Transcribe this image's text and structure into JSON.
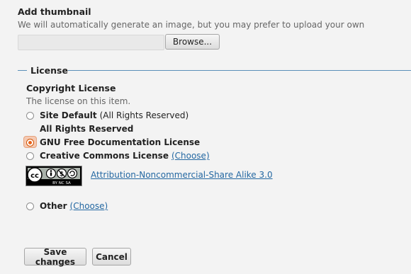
{
  "thumbnail": {
    "heading": "Add thumbnail",
    "help": "We will automatically generate an image, but you may prefer to upload your own",
    "browse_label": "Browse..."
  },
  "license": {
    "legend": "License",
    "heading": "Copyright License",
    "help": "The license on this item.",
    "options": [
      {
        "label": "Site Default",
        "suffix": "(All Rights Reserved)",
        "checked": false
      },
      {
        "label": "All Rights Reserved",
        "checked": false
      },
      {
        "label": "GNU Free Documentation License",
        "checked": true
      },
      {
        "label": "Creative Commons License",
        "link": "(Choose)",
        "checked": false
      },
      {
        "label": "Other",
        "link": "(Choose)",
        "checked": false
      }
    ],
    "cc_badge": {
      "text": "BY  NC  SA",
      "link": "Attribution-Noncommercial-Share Alike 3.0"
    }
  },
  "actions": {
    "save_label": "Save changes",
    "cancel_label": "Cancel"
  },
  "colors": {
    "background": "#f3f3f3",
    "link": "#2468a2",
    "legend_line": "#5b8fb9",
    "radio_checked": "#e8621a"
  }
}
